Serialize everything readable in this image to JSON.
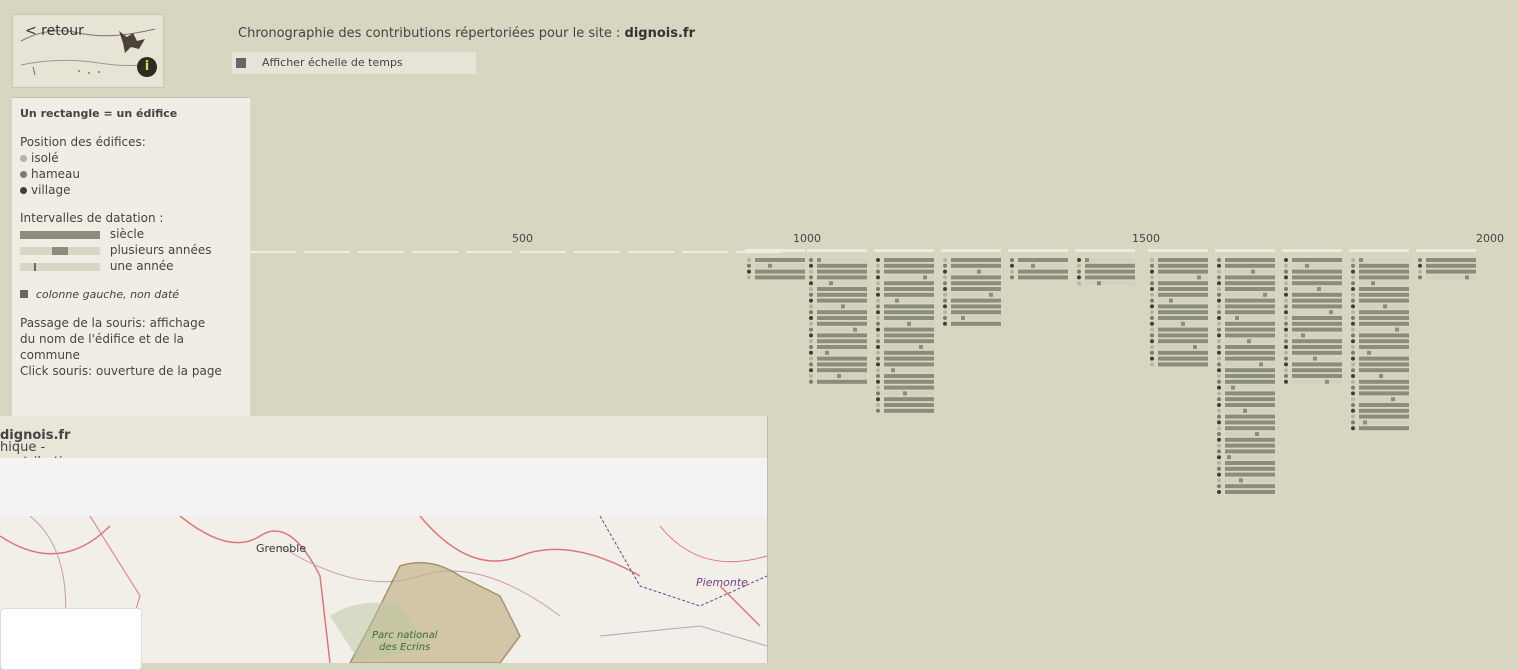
{
  "nav": {
    "back_label": "< retour",
    "info_icon": "i"
  },
  "legend": {
    "heading": "Un rectangle = un édifice",
    "position_title": "Position des édifices:",
    "positions": [
      {
        "label": "isolé",
        "color": "#b4b4a4"
      },
      {
        "label": "hameau",
        "color": "#7c7c6c"
      },
      {
        "label": "village",
        "color": "#3f3f33"
      }
    ],
    "intervals_title": "Intervalles de datation :",
    "intervals": [
      {
        "label": "siècle"
      },
      {
        "label": "plusieurs années"
      },
      {
        "label": "une année"
      }
    ],
    "undated_label": "colonne gauche, non daté",
    "hover_text_1": "Passage de la souris: affichage",
    "hover_text_2": "du nom de l'édifice et de la",
    "hover_text_3": "commune",
    "click_text": "Click souris: ouverture de la page"
  },
  "header": {
    "title_prefix": "Chronographie des contributions répertoriées pour le site :",
    "site": "dignois.fr"
  },
  "timescale": {
    "label": "Afficher échelle de temps"
  },
  "axis": {
    "ticks": [
      "500",
      "1000",
      "1500",
      "2000"
    ]
  },
  "overlay": {
    "title_prefix": "hique - contributions répertoriées pour le site",
    "site": "dignois.fr"
  },
  "map": {
    "labels": {
      "grenoble": "Grenoble",
      "piemonte": "Piemonte",
      "parc_1": "Parc national",
      "parc_2": "des Ecrins"
    }
  },
  "colors": {
    "background": "#d6d6c1",
    "bar": "#8c8c7c",
    "bar_light": "#d8d6c4"
  }
}
